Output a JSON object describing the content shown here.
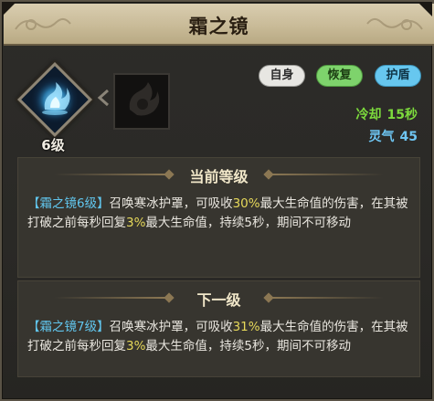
{
  "title": "霜之镜",
  "skill": {
    "level_label": "6级",
    "icon": "frost-mirror-skill-icon",
    "next_icon": "locked-skill-icon"
  },
  "tags": {
    "self": "自身",
    "recover": "恢复",
    "shield": "护盾"
  },
  "stats": {
    "cooldown_label": "冷却",
    "cooldown_value": "15秒",
    "spirit_label": "灵气",
    "spirit_value": "45"
  },
  "current": {
    "header": "当前等级",
    "name": "【霜之镜6级】",
    "text1": "召唤寒冰护罩，可吸收",
    "pct1": "30%",
    "text2": "最大生命值的伤害，在其被打破之前每秒回复",
    "pct2": "3%",
    "text3": "最大生命值，持续5秒，期间不可移动"
  },
  "next": {
    "header": "下一级",
    "name": "【霜之镜7级】",
    "text1": "召唤寒冰护罩，可吸收",
    "pct1": "31%",
    "text2": "最大生命值的伤害，在其被打破之前每秒回复",
    "pct2": "3%",
    "text3": "最大生命值，持续5秒，期间不可移动"
  },
  "colors": {
    "skill_name": "#61c6ee",
    "highlight": "#e6d85a",
    "cooldown": "#7ddb3d",
    "spirit": "#6ec5f2",
    "tag_recover": "#7ed36c",
    "tag_shield": "#67c7ef"
  }
}
